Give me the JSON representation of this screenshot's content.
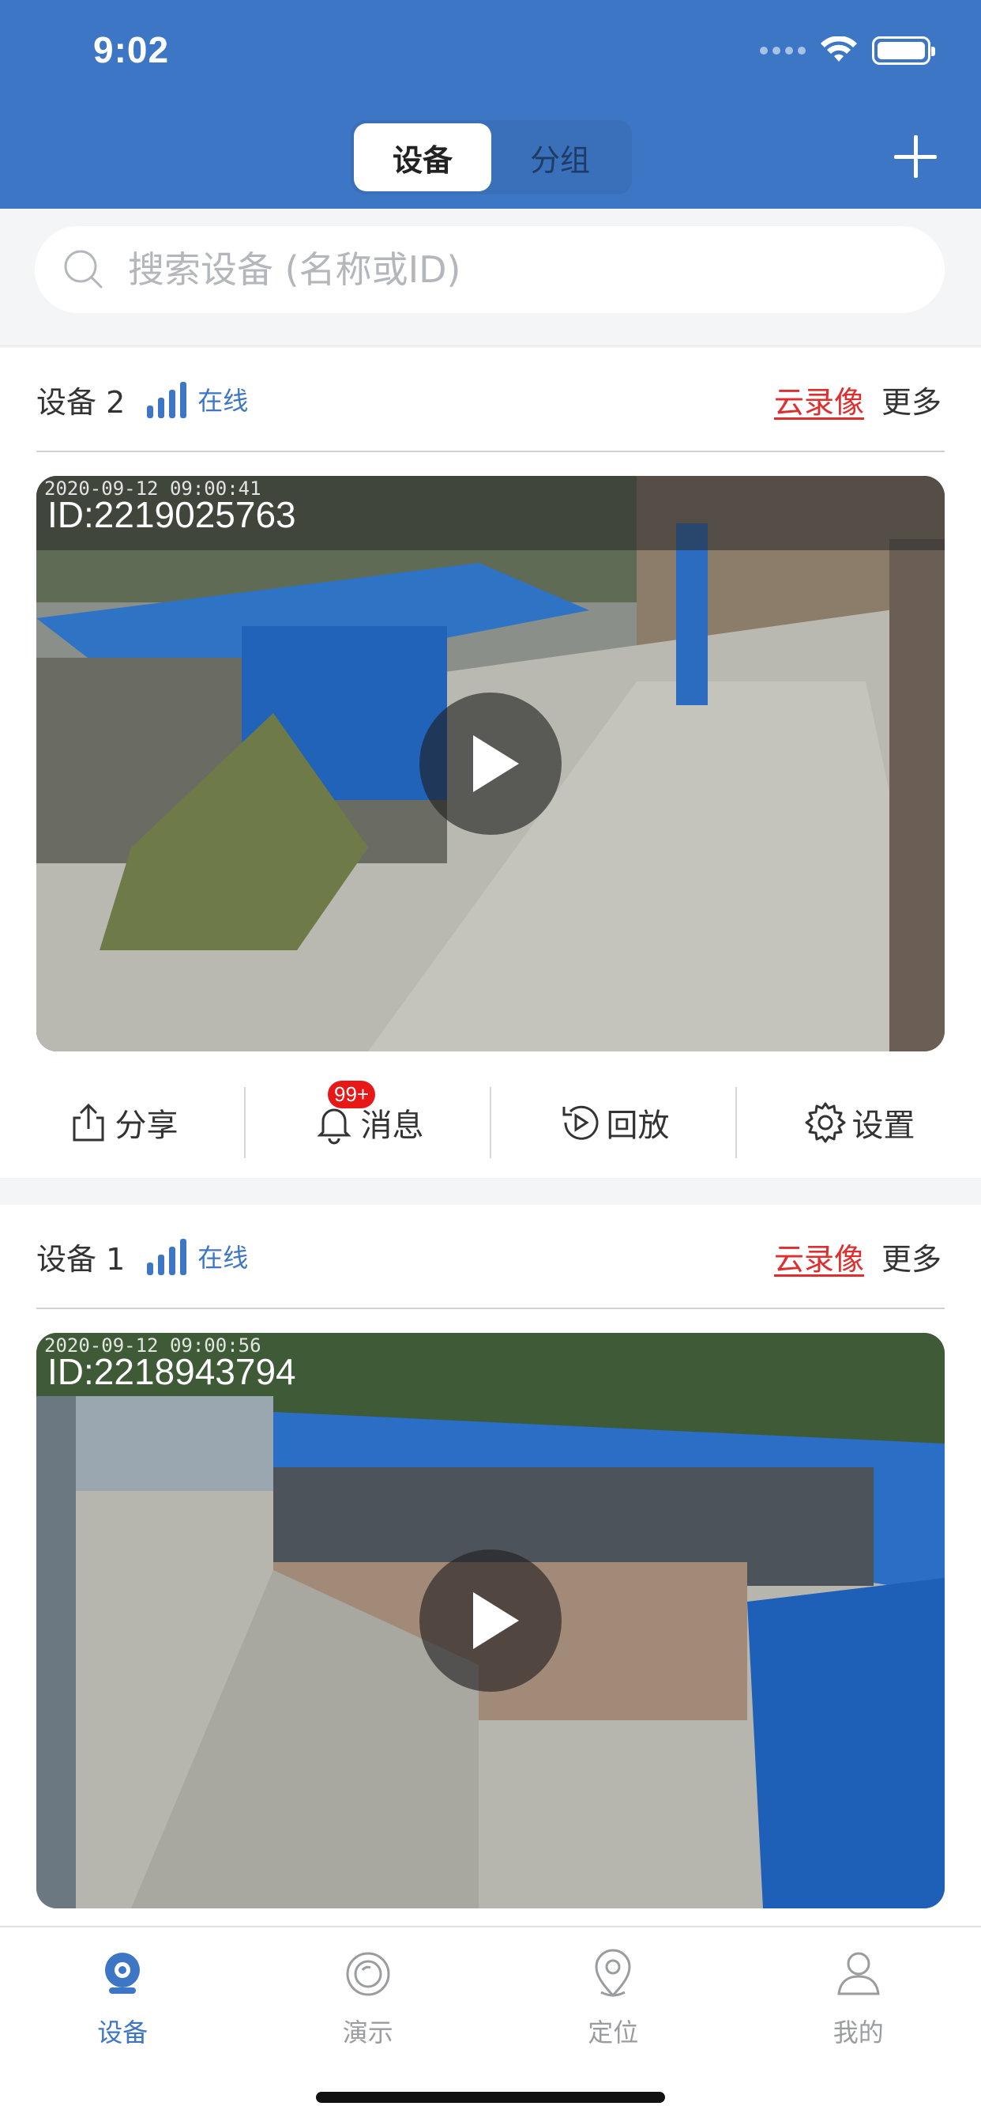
{
  "status_bar": {
    "time": "9:02"
  },
  "header": {
    "segments": [
      {
        "label": "设备",
        "active": true
      },
      {
        "label": "分组",
        "active": false
      }
    ],
    "accent_color": "#3e76c6"
  },
  "search": {
    "placeholder": "搜索设备 (名称或ID)"
  },
  "devices": [
    {
      "name": "设备 2",
      "status": "在线",
      "cloud_label": "云录像",
      "more_label": "更多",
      "timestamp": "2020-09-12 09:00:41",
      "id_text": "ID:2219025763"
    },
    {
      "name": "设备 1",
      "status": "在线",
      "cloud_label": "云录像",
      "more_label": "更多",
      "timestamp": "2020-09-12 09:00:56",
      "id_text": "ID:2218943794"
    }
  ],
  "card_actions": [
    {
      "label": "分享",
      "icon": "share-icon"
    },
    {
      "label": "消息",
      "icon": "bell-icon",
      "badge": "99+"
    },
    {
      "label": "回放",
      "icon": "playback-icon"
    },
    {
      "label": "设置",
      "icon": "gear-icon"
    }
  ],
  "tabbar": [
    {
      "label": "设备",
      "icon": "camera-icon",
      "active": true
    },
    {
      "label": "演示",
      "icon": "demo-icon",
      "active": false
    },
    {
      "label": "定位",
      "icon": "location-icon",
      "active": false
    },
    {
      "label": "我的",
      "icon": "profile-icon",
      "active": false
    }
  ]
}
